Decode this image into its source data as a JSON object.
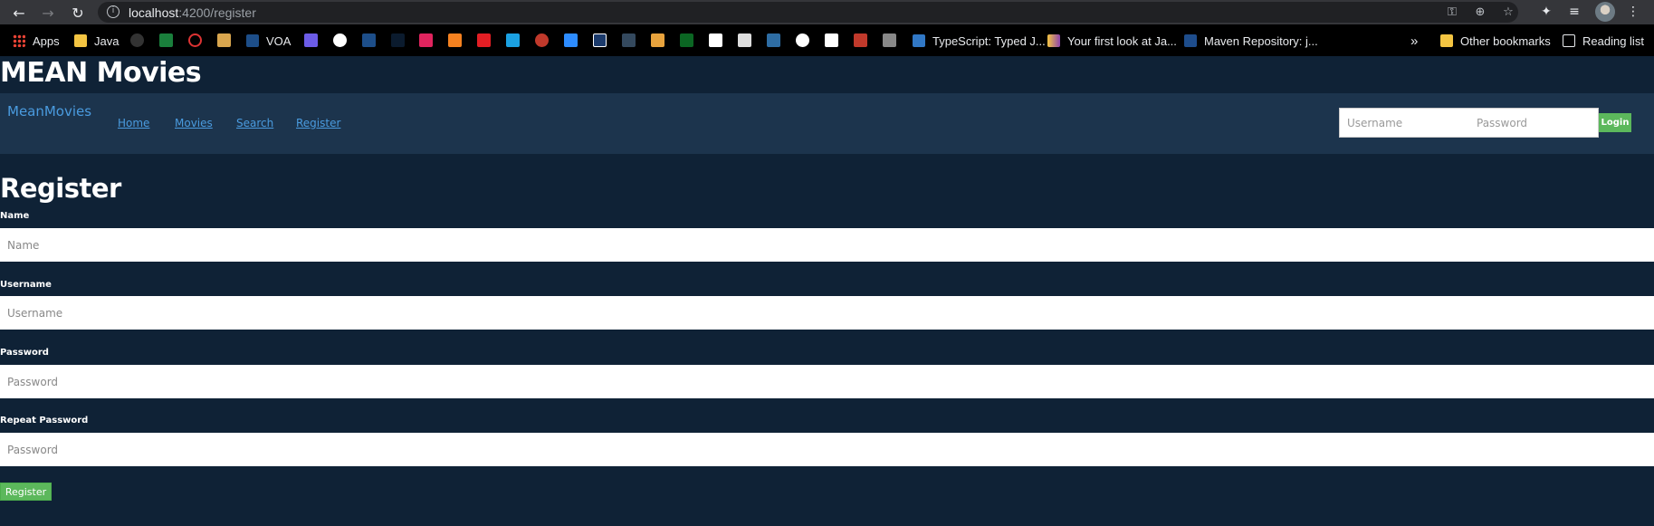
{
  "browser": {
    "url_host": "localhost",
    "url_path": ":4200/register"
  },
  "bookmarks": {
    "apps": "Apps",
    "java": "Java",
    "voa": "VOA",
    "typescript": "TypeScript: Typed J...",
    "first_look": "Your first look at Ja...",
    "maven": "Maven Repository: j...",
    "overflow": "»",
    "other": "Other bookmarks",
    "reading_list": "Reading list"
  },
  "site": {
    "title": "MEAN Movies",
    "brand": "MeanMovies",
    "nav": [
      "Home",
      "Movies",
      "Search",
      "Register"
    ]
  },
  "login": {
    "username_placeholder": "Username",
    "password_placeholder": "Password",
    "button": "Login"
  },
  "register": {
    "heading": "Register",
    "fields": [
      {
        "label": "Name",
        "placeholder": "Name"
      },
      {
        "label": "Username",
        "placeholder": "Username"
      },
      {
        "label": "Password",
        "placeholder": "Password"
      },
      {
        "label": "Repeat Password",
        "placeholder": "Password"
      }
    ],
    "button": "Register"
  },
  "colors": {
    "page_bg": "#0f2236",
    "navbar_bg": "#1c344d",
    "link": "#4a9bdf",
    "success": "#5cb85c"
  }
}
